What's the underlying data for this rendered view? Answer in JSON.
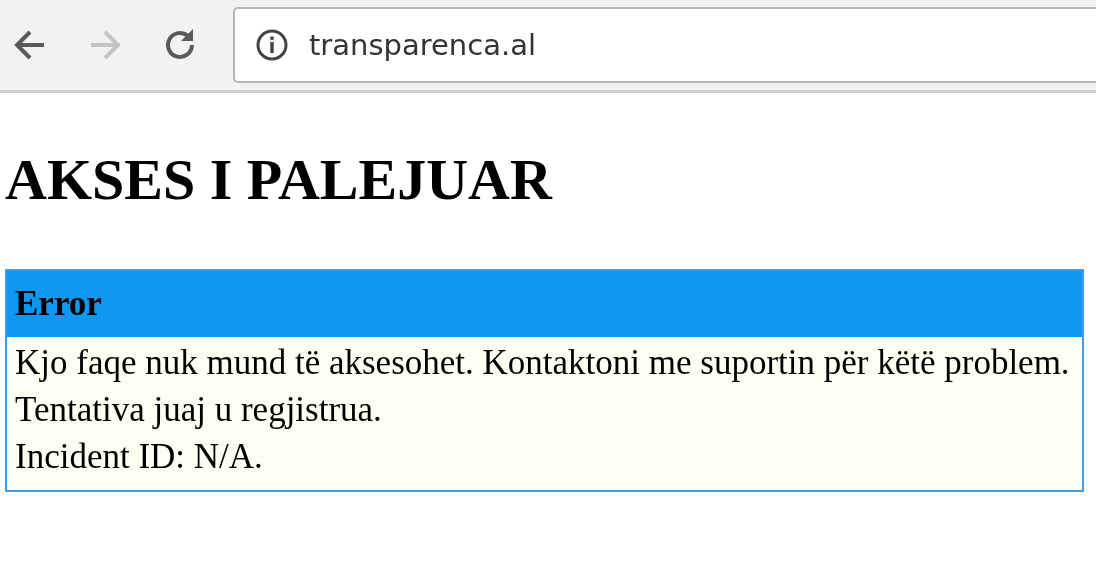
{
  "browser": {
    "url": "transparenca.al"
  },
  "heading": "AKSES I PALEJUAR",
  "error_box": {
    "title": "Error",
    "lines": [
      "Kjo faqe nuk mund të aksesohet. Kontaktoni me suportin për këtë problem.",
      "Tentativa juaj u regjistrua.",
      "Incident ID: N/A."
    ]
  }
}
